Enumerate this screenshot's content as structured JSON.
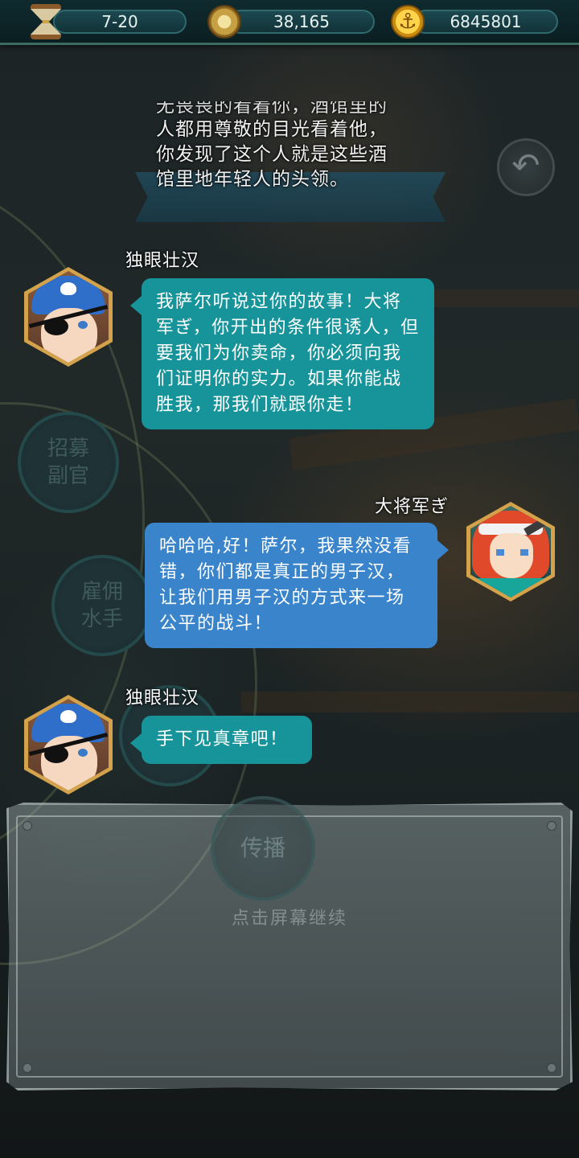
{
  "top_bar": {
    "stage": "7-20",
    "compass_value": "38,165",
    "gold_value": "6845801",
    "icons": [
      "hourglass-icon",
      "compass-icon",
      "anchor-icon"
    ]
  },
  "narration": {
    "line_partial": "无畏畏的看着你，酒馆里的",
    "lines": [
      "人都用尊敬的目光看着他，",
      "你发现了这个人就是这些酒",
      "馆里地年轻人的头领。"
    ]
  },
  "side_menu": {
    "recruit_officer": "招募副官",
    "hire_sailors": "雇佣水手",
    "broadcast": "传播"
  },
  "dialogue": [
    {
      "speaker": "独眼壮汉",
      "text": "我萨尔听说过你的故事！大将军ぎ，你开出的条件很诱人，但要我们为你卖命，你必须向我们证明你的实力。如果你能战胜我，那我们就跟你走！"
    },
    {
      "speaker": "大将军ぎ",
      "text": "哈哈哈,好！萨尔，我果然没看错，你们都是真正的男子汉，让我们用男子汉的方式来一场公平的战斗！"
    },
    {
      "speaker": "独眼壮汉",
      "text": "手下见真章吧！"
    }
  ],
  "hint": "点击屏幕继续",
  "colors": {
    "npc_bubble": "#17939a",
    "player_bubble": "#3a84cc",
    "portrait_frame": "#d3a24a"
  }
}
